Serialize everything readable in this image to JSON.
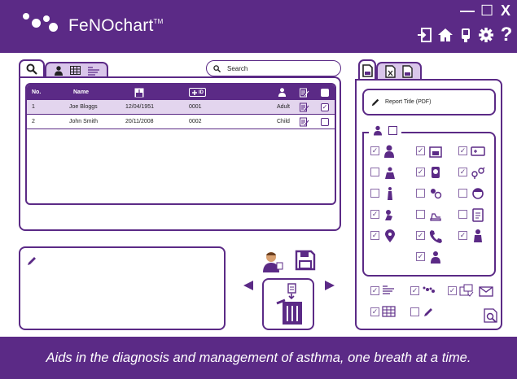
{
  "app": {
    "title": "FeNOchart",
    "trademark": "TM"
  },
  "window_controls": {
    "minimize": "—",
    "maximize": "☐",
    "close": "X"
  },
  "header_icons": [
    "exit-icon",
    "home-icon",
    "device-icon",
    "gear-icon",
    "help-icon"
  ],
  "header_help": "?",
  "left_tabs": [
    "search-icon",
    "person-icon",
    "table-icon",
    "report-icon"
  ],
  "search": {
    "placeholder": "Search"
  },
  "table": {
    "columns": {
      "no": "No.",
      "name": "Name",
      "id": "ID"
    },
    "rows": [
      {
        "no": "1",
        "name": "Joe Bloggs",
        "dob": "12/04/1951",
        "id": "0001",
        "type": "Adult",
        "checked": true,
        "selected": true
      },
      {
        "no": "2",
        "name": "John Smith",
        "dob": "20/11/2008",
        "id": "0002",
        "type": "Child",
        "checked": false,
        "selected": false
      }
    ]
  },
  "right_tabs": [
    "pdf-file-icon",
    "excel-file-icon",
    "csv-file-icon"
  ],
  "report": {
    "title_placeholder": "Report Title (PDF)"
  },
  "options": {
    "patient_checked": false,
    "grid_checked": [
      true,
      true,
      true,
      false,
      true,
      true,
      false,
      false,
      false,
      true,
      false,
      false,
      true,
      true,
      true,
      true
    ],
    "bottom_checked": [
      true,
      true,
      true,
      true,
      false
    ]
  },
  "footer": {
    "tagline": "Aids in the diagnosis and management of asthma, one breath at a time."
  },
  "colors": {
    "primary": "#5b2a86",
    "primary_light": "#d9c6ea"
  }
}
